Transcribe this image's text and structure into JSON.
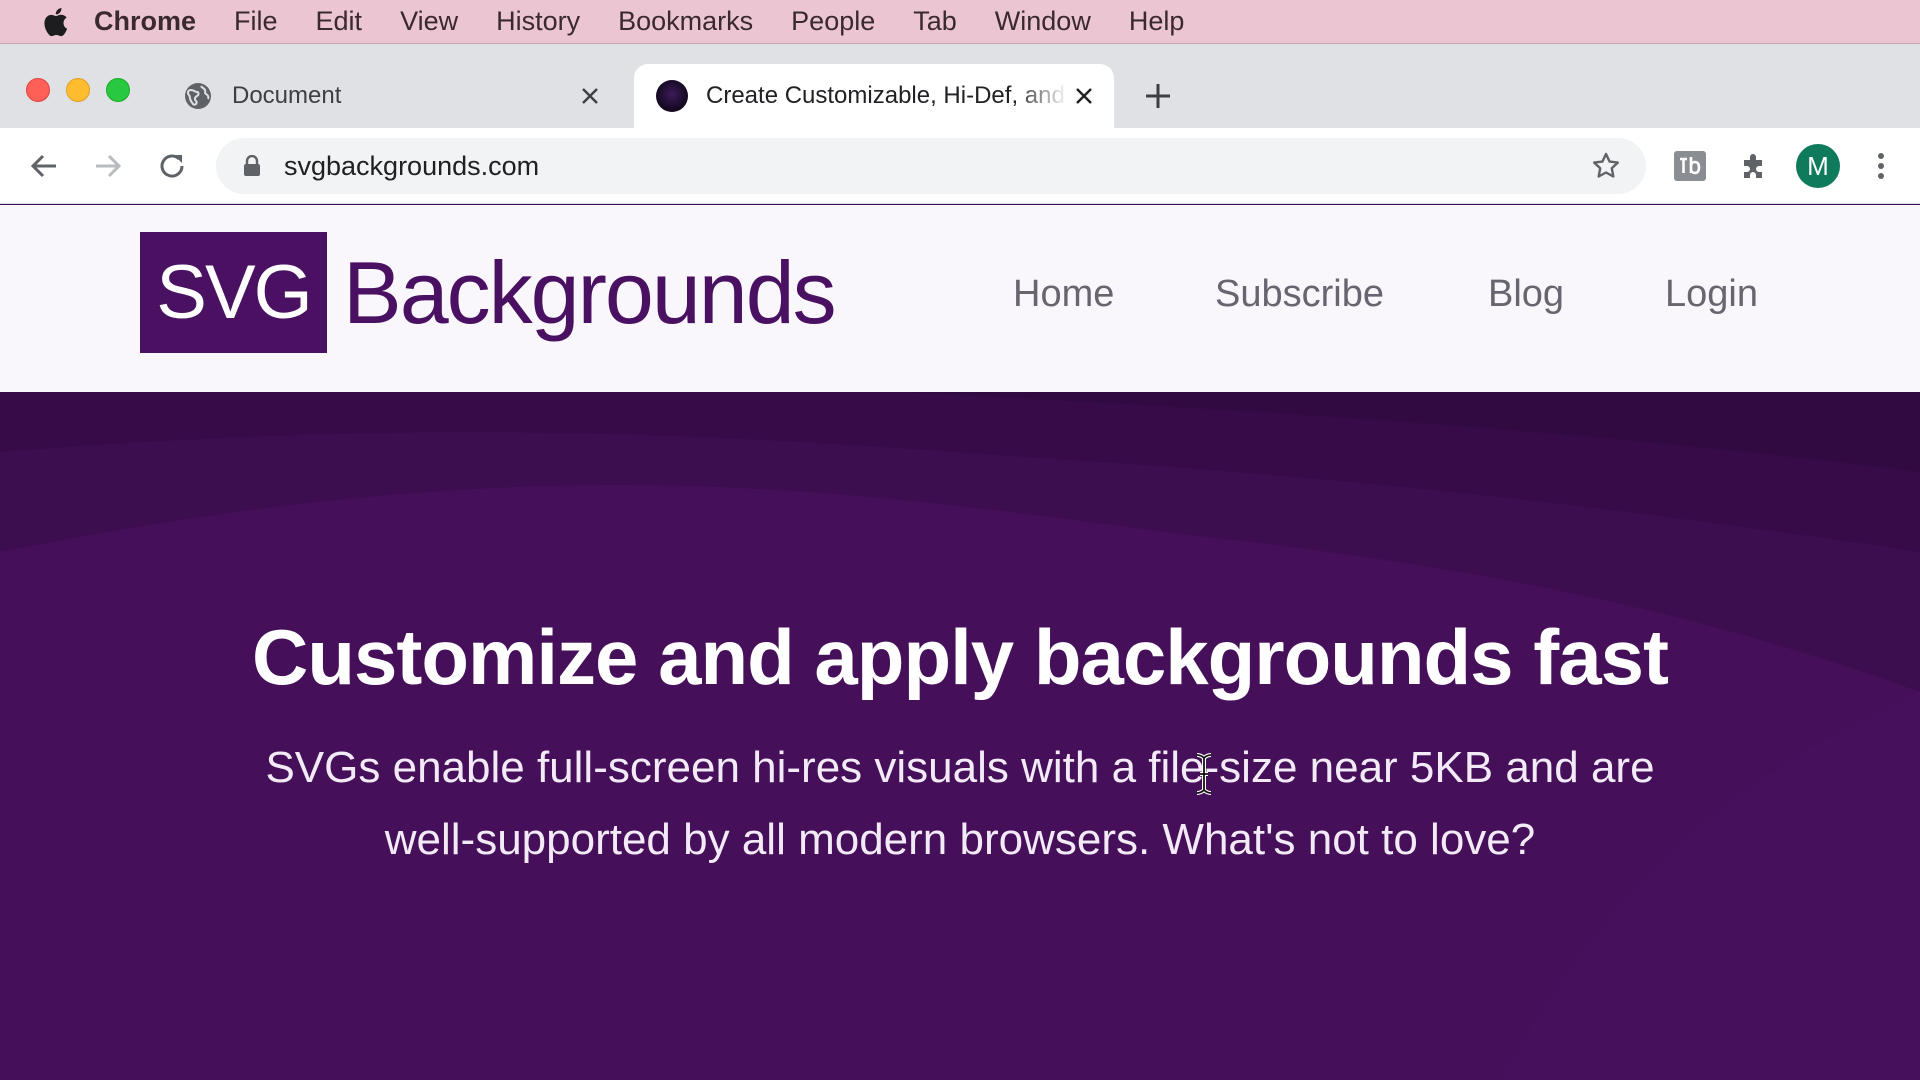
{
  "menubar": {
    "app": "Chrome",
    "items": [
      "File",
      "Edit",
      "View",
      "History",
      "Bookmarks",
      "People",
      "Tab",
      "Window",
      "Help"
    ]
  },
  "tabs": [
    {
      "title": "Document",
      "active": false
    },
    {
      "title": "Create Customizable, Hi-Def, and Lightweight Backgrounds",
      "active": true
    }
  ],
  "toolbar": {
    "url": "svgbackgrounds.com",
    "avatar_letter": "M"
  },
  "site": {
    "logo_box": "SVG",
    "logo_text": "Backgrounds",
    "nav": [
      "Home",
      "Subscribe",
      "Blog",
      "Login"
    ]
  },
  "hero": {
    "title": "Customize and apply backgrounds fast",
    "subtitle": "SVGs enable full-screen hi-res visuals with a file-size near 5KB and are well-supported by all modern browsers. What's not to love?"
  },
  "colors": {
    "brand_purple": "#4a1162",
    "hero_bg": "#450f59",
    "menubar_bg": "#ecc5d2",
    "avatar_bg": "#0f7a5c"
  }
}
